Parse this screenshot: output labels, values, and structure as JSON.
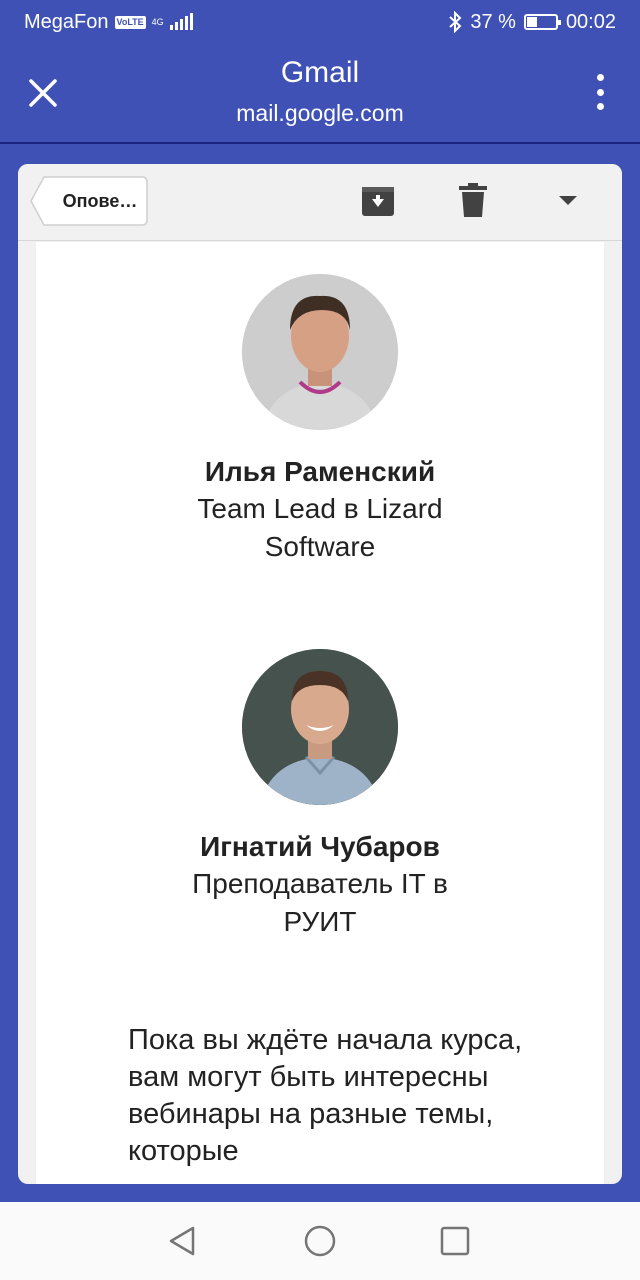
{
  "status_bar": {
    "carrier": "MegaFon",
    "volte": "VoLTE",
    "network": "4G",
    "battery_percent": "37 %",
    "battery_level": 0.37,
    "time": "00:02",
    "icons": [
      "bluetooth-icon",
      "signal-icon",
      "battery-icon"
    ]
  },
  "header": {
    "title": "Gmail",
    "subtitle": "mail.google.com"
  },
  "toolbar": {
    "back_label": "Опове…",
    "icons": [
      "archive-icon",
      "delete-icon",
      "more-dropdown-icon"
    ]
  },
  "people": [
    {
      "name": "Илья Раменский",
      "role": "Team Lead в Lizard Software"
    },
    {
      "name": "Игнатий Чубаров",
      "role": "Преподаватель IT в РУИТ"
    }
  ],
  "body_text": "Пока вы ждёте начала курса, вам могут быть интересны вебинары на разные темы, которые",
  "colors": {
    "primary": "#3f51b5",
    "card_bg": "#f1f1f1",
    "content_bg": "#ffffff"
  },
  "nav": {
    "icons": [
      "back-triangle-icon",
      "home-circle-icon",
      "recents-square-icon"
    ]
  }
}
